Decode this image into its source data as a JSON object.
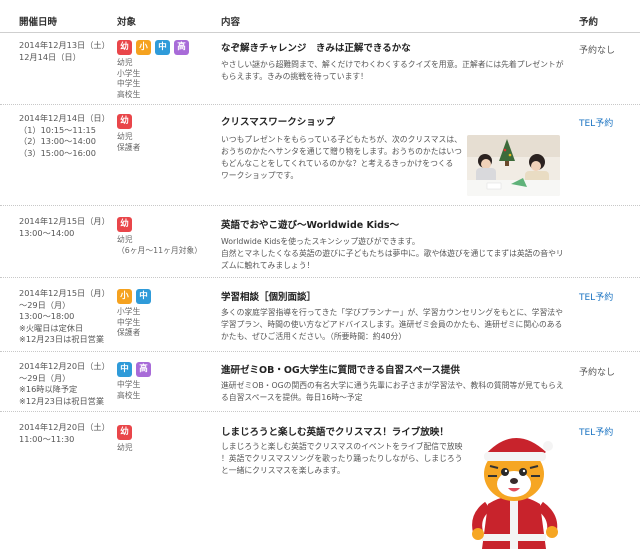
{
  "header": {
    "date": "開催日時",
    "target": "対象",
    "content": "内容",
    "reservation": "予約"
  },
  "colors": {
    "幼": "#e9464a",
    "小": "#f5a21f",
    "中": "#2f9bd9",
    "高": "#a86bd8",
    "tel_link": "#1a73c2"
  },
  "events": [
    {
      "date_lines": [
        "2014年12月13日（土）",
        "12月14日（日）"
      ],
      "badges": [
        "幼",
        "小",
        "中",
        "高"
      ],
      "target_lines": [
        "幼児",
        "小学生",
        "中学生",
        "高校生"
      ],
      "title": "なぞ解きチャレンジ　きみは正解できるかな",
      "desc_lines": [
        "やさしい謎から超難問まで、解くだけでわくわくするクイズを用意。正解者には先着プレゼントが",
        "もらえます。きみの挑戦を待っています！"
      ],
      "reservation": "予約なし"
    },
    {
      "date_lines": [
        "2014年12月14日（日）",
        "（1）10:15～11:15",
        "（2）13:00～14:00",
        "（3）15:00～16:00"
      ],
      "badges": [
        "幼"
      ],
      "target_lines": [
        "幼児",
        "保護者"
      ],
      "title": "クリスマスワークショップ",
      "desc_lines": [
        "いつもプレゼントをもらっている子どもたちが、次のクリスマスは、",
        "おうちのかたへサンタを通じて贈り物をします。おうちのかたはいつ",
        "もどんなことをしてくれているのかな？と考えるきっかけをつくる",
        "ワークショップです。"
      ],
      "reservation": "TEL予約"
    },
    {
      "date_lines": [
        "2014年12月15日（月）",
        "13:00～14:00"
      ],
      "badges": [
        "幼"
      ],
      "target_lines": [
        "幼児",
        "（6ヶ月～11ヶ月対象）"
      ],
      "title": "英語でおやこ遊び～Worldwide Kids～",
      "desc_lines": [
        "Worldwide Kidsを使ったスキンシップ遊びができます。",
        "自然とマネしたくなる英語の遊びに子どもたちは夢中に。歌や体遊びを通じてまずは英語の音やリ",
        "ズムに触れてみましょう！"
      ],
      "reservation": ""
    },
    {
      "date_lines": [
        "2014年12月15日（月）",
        "～29日（月）",
        "13:00～18:00",
        "※火曜日は定休日",
        "※12月23日は祝日営業"
      ],
      "badges": [
        "小",
        "中"
      ],
      "target_lines": [
        "小学生",
        "中学生",
        "保護者"
      ],
      "title": "学習相談［個別面談］",
      "desc_lines": [
        "多くの家庭学習指導を行ってきた「学びプランナー」が、学習カウンセリングをもとに、学習法や",
        "学習プラン、時間の使い方などアドバイスします。進研ゼミ会員のかたも、進研ゼミに関心のある",
        "かたも、ぜひご活用ください。（所要時間：約40分）"
      ],
      "reservation": "TEL予約"
    },
    {
      "date_lines": [
        "2014年12月20日（土）",
        "～29日（月）",
        "※16時以降予定",
        "※12月23日は祝日営業"
      ],
      "badges": [
        "中",
        "高"
      ],
      "target_lines": [
        "中学生",
        "高校生"
      ],
      "title": "進研ゼミOB・OG大学生に質問できる自習スペース提供",
      "desc_lines": [
        "進研ゼミOB・OGの関西の有名大学に通う先輩にお子さまが学習法や、教科の質問等が見てもらえ",
        "る自習スペースを提供。毎日16時～予定"
      ],
      "reservation": "予約なし"
    },
    {
      "date_lines": [
        "2014年12月20日（土）",
        "11:00～11:30"
      ],
      "badges": [
        "幼"
      ],
      "target_lines": [
        "幼児"
      ],
      "title": "しまじろうと楽しむ英語でクリスマス！ライブ放映！",
      "desc_lines": [
        "しまじろうと楽しむ英語でクリスマスのイベントをライブ配信で放映",
        "！英語でクリスマスソングを歌ったり踊ったりしながら、しまじろう",
        "と一緒にクリスマスを楽しみます。"
      ],
      "reservation": "TEL予約"
    }
  ]
}
